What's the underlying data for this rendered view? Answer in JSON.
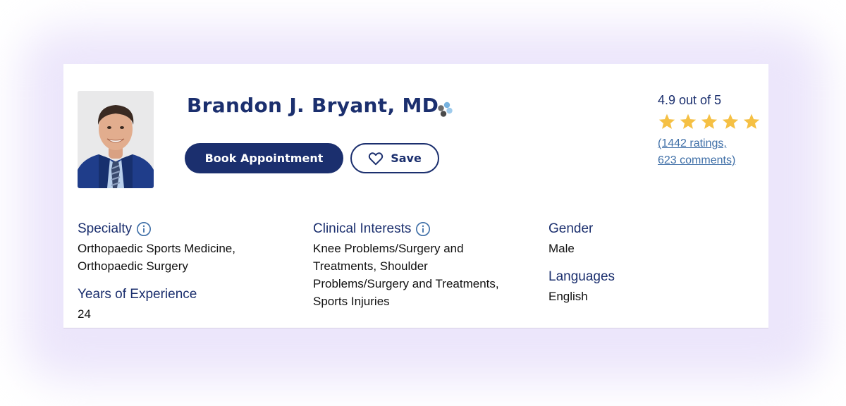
{
  "doctor": {
    "name": "Brandon J. Bryant, MD",
    "photo_alt": "Doctor headshot",
    "badge_icon": "people-group-icon"
  },
  "actions": {
    "book_label": "Book Appointment",
    "save_label": "Save",
    "save_icon": "heart-outline-icon"
  },
  "rating": {
    "score_text": "4.9 out of 5",
    "stars_filled": 5,
    "stars_total": 5,
    "link_line1": "(1442 ratings,",
    "link_line2": "623 comments)"
  },
  "details": {
    "specialty": {
      "label": "Specialty",
      "line1": "Orthopaedic Sports Medicine,",
      "line2": "Orthopaedic Surgery"
    },
    "experience": {
      "label": "Years of Experience",
      "value": "24"
    },
    "interests": {
      "label": "Clinical Interests",
      "line1": "Knee Problems/Surgery and",
      "line2": "Treatments, Shoulder",
      "line3": "Problems/Surgery and Treatments,",
      "line4": "Sports Injuries"
    },
    "gender": {
      "label": "Gender",
      "value": "Male"
    },
    "languages": {
      "label": "Languages",
      "value": "English"
    }
  },
  "colors": {
    "brand_navy": "#1b2f6e",
    "star_gold": "#f5c044",
    "link_blue": "#3f6fa7",
    "glow_lavender": "#ece6fb"
  }
}
